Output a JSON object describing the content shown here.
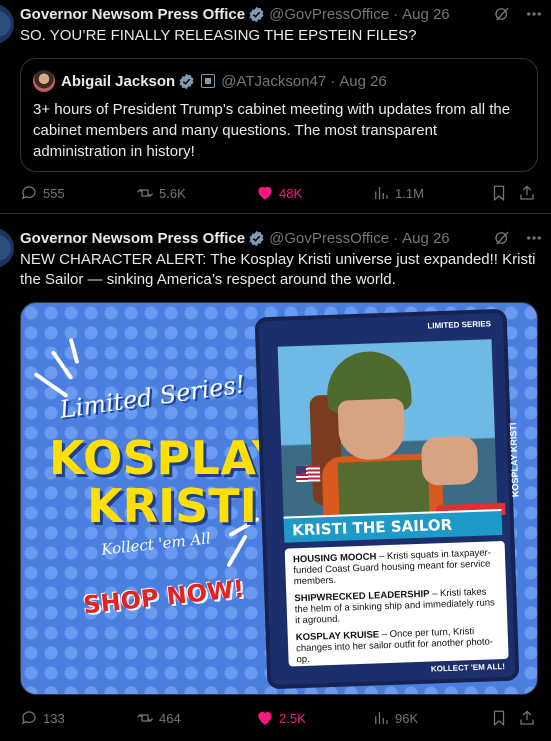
{
  "tweet1": {
    "author_name": "Governor Newsom Press Office",
    "handle": "@GovPressOffice",
    "date": "Aug 26",
    "text": "SO. YOU’RE FINALLY RELEASING THE EPSTEIN FILES?",
    "quote": {
      "author_name": "Abigail Jackson",
      "handle": "@ATJackson47",
      "date": "Aug 26",
      "text": "3+ hours of President Trump’s cabinet meeting with updates from all the cabinet members and many questions. The most transparent administration in history!"
    },
    "stats": {
      "replies": "555",
      "reposts": "5.6K",
      "likes": "48K",
      "views": "1.1M"
    }
  },
  "tweet2": {
    "author_name": "Governor Newsom Press Office",
    "handle": "@GovPressOffice",
    "date": "Aug 26",
    "text": "NEW CHARACTER ALERT: The Kosplay Kristi universe just expanded!! Kristi the Sailor — sinking America’s respect around the world.",
    "media": {
      "limited_series": "Limited Series!",
      "title_line1": "KOSPLAY",
      "title_line2": "KRISTI",
      "kollect": "Kollect 'em All",
      "shop_now": "SHOP NOW!",
      "card": {
        "tag": "LIMITED SERIES",
        "vertical_label": "KOSPLAY KRISTI",
        "name": "KRISTI THE SAILOR",
        "ability1_title": "HOUSING MOOCH",
        "ability1_text": " – Kristi squats in taxpayer-funded Coast Guard housing meant for service members.",
        "ability2_title": "SHIPWRECKED LEADERSHIP",
        "ability2_text": " – Kristi takes the helm of a sinking ship and immediately runs it aground.",
        "ability3_title": "KOSPLAY KRUISE",
        "ability3_text": " – Once per turn, Kristi changes into her sailor outfit for another photo-op.",
        "footer": "KOLLECT 'EM ALL!"
      }
    },
    "stats": {
      "replies": "133",
      "reposts": "464",
      "likes": "2.5K",
      "views": "96K"
    }
  },
  "colors": {
    "like_pink": "#f91880",
    "muted": "#71767b",
    "verified_gray": "#829aab"
  }
}
